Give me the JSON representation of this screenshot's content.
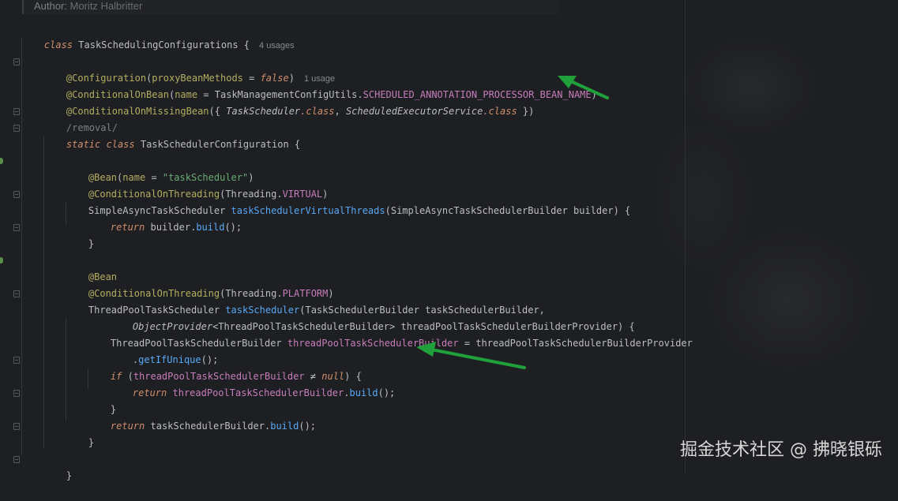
{
  "author": {
    "label": "Author:",
    "name": "Moritz Halbritter"
  },
  "lines": {
    "l1": {
      "kw": "class",
      "name": "TaskSchedulingConfigurations",
      "brace": " {",
      "hint": "4 usages"
    },
    "l2": {
      "ann": "@Configuration",
      "p1": "(",
      "arg": "proxyBeanMethods",
      "eq": " = ",
      "val": "false",
      "p2": ")",
      "hint": "1 usage"
    },
    "l3": {
      "ann": "@ConditionalOnBean",
      "p1": "(",
      "arg": "name",
      "eq": " = ",
      "cls": "TaskManagementConfigUtils",
      "dot": ".",
      "const": "SCHEDULED_ANNOTATION_PROCESSOR_BEAN_NAME",
      "p2": ")"
    },
    "l4": {
      "ann": "@ConditionalOnMissingBean",
      "p1": "({ ",
      "t1": "TaskScheduler",
      "c1": ".class",
      "sep": ", ",
      "t2": "ScheduledExecutorService",
      "c2": ".class",
      "p2": " })"
    },
    "l5": {
      "comment": "/removal/"
    },
    "l6": {
      "kw1": "static",
      "kw2": "class",
      "name": "TaskSchedulerConfiguration",
      "brace": " {"
    },
    "l7": {
      "ann": "@Bean",
      "p1": "(",
      "arg": "name",
      "eq": " = ",
      "str": "\"taskScheduler\"",
      "p2": ")"
    },
    "l8": {
      "ann": "@ConditionalOnThreading",
      "p1": "(",
      "cls": "Threading",
      "dot": ".",
      "const": "VIRTUAL",
      "p2": ")"
    },
    "l9": {
      "type": "SimpleAsyncTaskScheduler",
      "fn": "taskSchedulerVirtualThreads",
      "p1": "(",
      "ptype": "SimpleAsyncTaskSchedulerBuilder",
      "pname": " builder",
      "p2": ") {"
    },
    "l10": {
      "kw": "return",
      "obj": "builder",
      "dot": ".",
      "m": "build",
      "end": "();"
    },
    "l11": {
      "brace": "}"
    },
    "l12": {
      "ann": "@Bean"
    },
    "l13": {
      "ann": "@ConditionalOnThreading",
      "p1": "(",
      "cls": "Threading",
      "dot": ".",
      "const": "PLATFORM",
      "p2": ")"
    },
    "l14": {
      "type": "ThreadPoolTaskScheduler",
      "fn": "taskScheduler",
      "p1": "(",
      "ptype": "TaskSchedulerBuilder",
      "pname": " taskSchedulerBuilder,",
      "p2": ""
    },
    "l15": {
      "t1": "ObjectProvider",
      "lt": "<",
      "t2": "ThreadPoolTaskSchedulerBuilder",
      "gt": ">",
      "pname": " threadPoolTaskSchedulerBuilderProvider",
      "end": ") {"
    },
    "l16": {
      "type": "ThreadPoolTaskSchedulerBuilder",
      "var": "threadPoolTaskSchedulerBuilder",
      "eq": " = ",
      "rhs": "threadPoolTaskSchedulerBuilderProvider"
    },
    "l17": {
      "dot": ".",
      "m": "getIfUnique",
      "end": "();"
    },
    "l18": {
      "kw": "if",
      "p1": " (",
      "var": "threadPoolTaskSchedulerBuilder",
      "op": " ≠ ",
      "nul": "null",
      "end": ") {"
    },
    "l19": {
      "kw": "return",
      "obj": "threadPoolTaskSchedulerBuilder",
      "dot": ".",
      "m": "build",
      "end": "();"
    },
    "l20": {
      "brace": "}"
    },
    "l21": {
      "kw": "return",
      "obj": "taskSchedulerBuilder",
      "dot": ".",
      "m": "build",
      "end": "();"
    },
    "l22": {
      "brace": "}"
    },
    "l23": {
      "brace": "}"
    }
  },
  "watermark": "掘金技术社区 @ 拂晓银砾",
  "colors": {
    "background": "#1e1f22",
    "keyword": "#cf8e6d",
    "annotation": "#b3ae60",
    "string": "#6aab73",
    "constant": "#c77dbb",
    "method": "#56a8f5",
    "text": "#bcbec4",
    "arrow": "#1fa03a"
  }
}
